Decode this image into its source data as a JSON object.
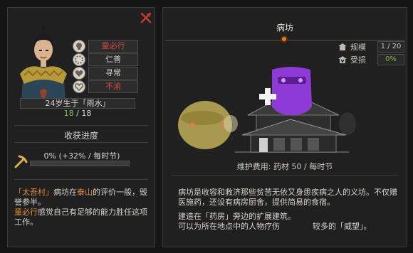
{
  "left": {
    "traits": [
      {
        "icon": "skull-icon",
        "value": "童必行",
        "color": "red"
      },
      {
        "icon": "dotted-ring-icon",
        "value": "仁善",
        "color": "pale"
      },
      {
        "icon": "heart-icon",
        "value": "寻常",
        "color": "pale"
      },
      {
        "icon": "heart-outline-icon",
        "value": "不渝",
        "color": "red"
      }
    ],
    "age_text": "24岁生于「雨水」",
    "hp_current": "18",
    "hp_sep": "/",
    "hp_max": "18",
    "harvest_title": "收获进度",
    "progress_text": "0% (+32% / 每时节)",
    "progress_fraction": 0.0,
    "desc": {
      "village": "「太吾村」",
      "building": "病坊",
      "in": "在",
      "place": "泰山",
      "rest1": "的评价一般，毁誉参半。",
      "person": "童必行",
      "rest2": "感觉自己有足够的能力胜任这项工作。"
    }
  },
  "right": {
    "title": "病坊",
    "stats": [
      {
        "icon": "building-icon",
        "label": "规模",
        "value": "1 / 20",
        "tone": "normal"
      },
      {
        "icon": "damage-icon",
        "label": "受损",
        "value": "0%",
        "tone": "green"
      }
    ],
    "cost_label": "维护费用:",
    "cost_value": "药材 50 / 每时节",
    "desc1": "病坊是收容和救济那些贫苦无依又身患疾病之人的义坊。不仅赠医施药，还设有病房厨舍，提供简易的食宿。",
    "desc2_a": "建造在「药房」旁边的扩展建筑。",
    "desc2_b": "可以为所在地点中的人物疗伤",
    "desc2_c": "较多的「威望」。"
  },
  "colors": {
    "accent_orange": "#e08a3a",
    "alert_red": "#d44b3b",
    "health_green": "#7bbf4a"
  }
}
